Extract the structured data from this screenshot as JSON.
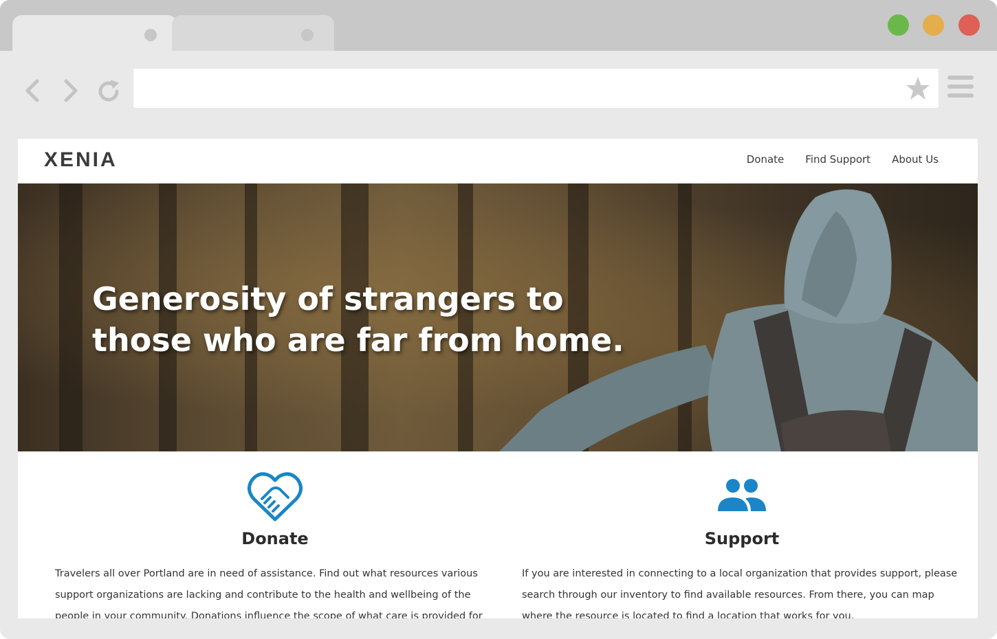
{
  "browser": {
    "address_value": "",
    "colors": {
      "close": "#df6056",
      "minimize": "#e4ae4c",
      "maximize": "#6ab84a"
    }
  },
  "site": {
    "logo": "XENIA",
    "nav": [
      {
        "label": "Donate"
      },
      {
        "label": "Find Support"
      },
      {
        "label": "About Us"
      }
    ]
  },
  "hero": {
    "headline_line1": "Generosity of strangers to",
    "headline_line2": "those who are far from home."
  },
  "features": {
    "donate": {
      "icon": "handshake-heart-icon",
      "title": "Donate",
      "text": "Travelers all over Portland are in need of assistance. Find out what resources various support organizations are lacking and contribute to the health and wellbeing of the people in your community. Donations influence the scope of what care is provided for"
    },
    "support": {
      "icon": "users-icon",
      "title": "Support",
      "text": "If you are interested in connecting to a local organization that provides support, please search through our inventory to find available resources. From there, you can map where the resource is located to find a location that works for you."
    }
  },
  "accent_color": "#1a86c7"
}
